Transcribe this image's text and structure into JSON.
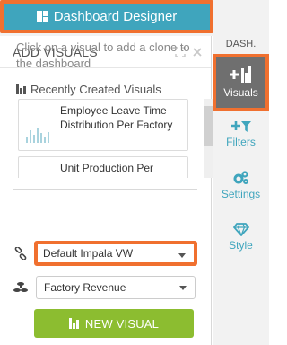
{
  "header": {
    "designer_label": "Dashboard Designer"
  },
  "panel": {
    "title": "ADD VISUALS",
    "help_text": "Click on a visual to add a clone to the dashboard",
    "recent_label": "Recently Created Visuals",
    "recent_items": [
      {
        "label": "Employee Leave Time Distribution Per Factory"
      },
      {
        "label": "Unit Production Per"
      }
    ],
    "connection_select": {
      "value": "Default Impala VW"
    },
    "dataset_select": {
      "value": "Factory Revenue"
    },
    "new_visual_label": "NEW VISUAL"
  },
  "sidebar": {
    "dash_label": "DASH.",
    "items": [
      {
        "label": "Visuals",
        "icon": "plus-chart-icon"
      },
      {
        "label": "Filters",
        "icon": "plus-filter-icon"
      },
      {
        "label": "Settings",
        "icon": "gears-icon"
      },
      {
        "label": "Style",
        "icon": "diamond-icon"
      }
    ]
  },
  "colors": {
    "accent": "#3fa5bd",
    "highlight": "#f0702f",
    "button_green": "#8cbd30",
    "active_tab": "#6f6f6f"
  }
}
